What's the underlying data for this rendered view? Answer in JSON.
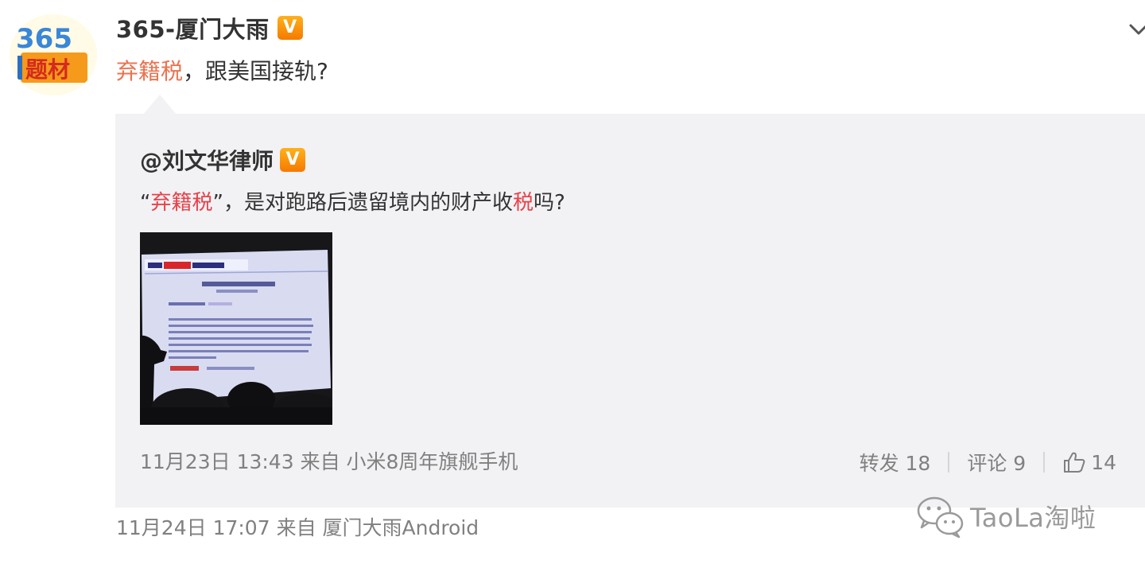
{
  "post": {
    "author": "365-厦门大雨",
    "verified_badge": "V",
    "text_parts": [
      {
        "text": "弃籍税",
        "style": "highlight"
      },
      {
        "text": "，跟美国接轨?",
        "style": "normal"
      }
    ],
    "footer": "11月24日 17:07 来自 厦门大雨Android"
  },
  "avatar": {
    "number_text": "365",
    "label_text": "题材"
  },
  "quoted": {
    "author": "@刘文华律师",
    "verified_badge": "V",
    "text_parts": [
      {
        "text": "“",
        "style": "normal"
      },
      {
        "text": "弃籍税",
        "style": "highlight"
      },
      {
        "text": "”，是对跑路后遗留境内的财产收",
        "style": "normal"
      },
      {
        "text": "税",
        "style": "highlight"
      },
      {
        "text": "吗?",
        "style": "normal"
      }
    ],
    "meta": "11月23日 13:43 来自 小米8周年旗舰手机",
    "actions": {
      "repost_label": "转发 18",
      "comment_label": "评论 9",
      "like_count": "14"
    }
  },
  "watermark": {
    "text": "TaoLa淘啦"
  },
  "colors": {
    "highlight": "#eb7350",
    "badge_orange": "#f57a00",
    "card_background": "#f2f2f5",
    "meta_gray": "#808080"
  },
  "icons": [
    "chevron-down-icon",
    "verified-icon",
    "thumb-up-icon",
    "wechat-icon"
  ]
}
